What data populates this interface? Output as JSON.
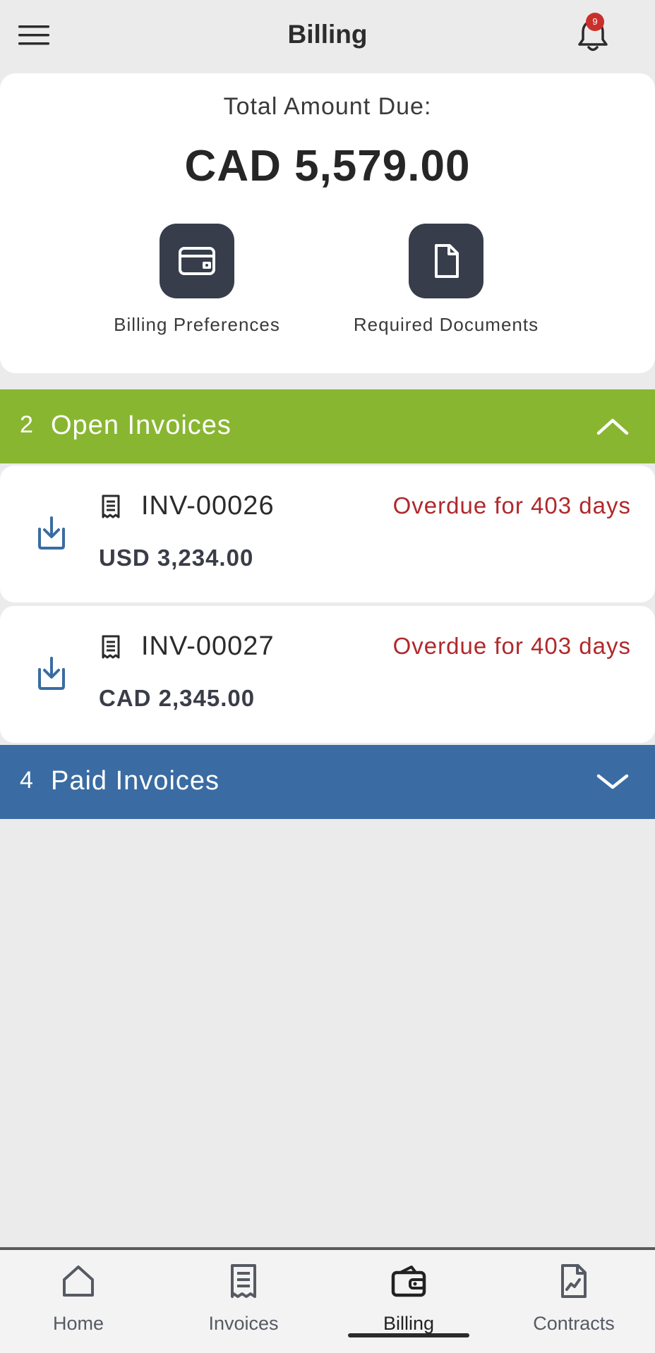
{
  "header": {
    "title": "Billing",
    "notification_count": "9"
  },
  "summary": {
    "total_label": "Total Amount Due:",
    "total_amount": "CAD 5,579.00",
    "actions": [
      {
        "label": "Billing Preferences",
        "icon": "wallet-card-icon"
      },
      {
        "label": "Required Documents",
        "icon": "document-icon"
      }
    ]
  },
  "open_invoices": {
    "count": "2",
    "title": "Open Invoices",
    "expanded": true,
    "items": [
      {
        "number": "INV-00026",
        "status": "Overdue for 403 days",
        "amount": "USD 3,234.00"
      },
      {
        "number": "INV-00027",
        "status": "Overdue for 403 days",
        "amount": "CAD 2,345.00"
      }
    ]
  },
  "paid_invoices": {
    "count": "4",
    "title": "Paid Invoices",
    "expanded": false
  },
  "nav": {
    "items": [
      {
        "label": "Home",
        "icon": "home-icon"
      },
      {
        "label": "Invoices",
        "icon": "receipt-icon"
      },
      {
        "label": "Billing",
        "icon": "wallet-icon",
        "active": true
      },
      {
        "label": "Contracts",
        "icon": "contract-chart-icon"
      }
    ]
  },
  "colors": {
    "open_header": "#89b631",
    "paid_header": "#3a6ca3",
    "overdue": "#b0282b",
    "action_tile": "#373d4a",
    "badge": "#c9302c"
  }
}
